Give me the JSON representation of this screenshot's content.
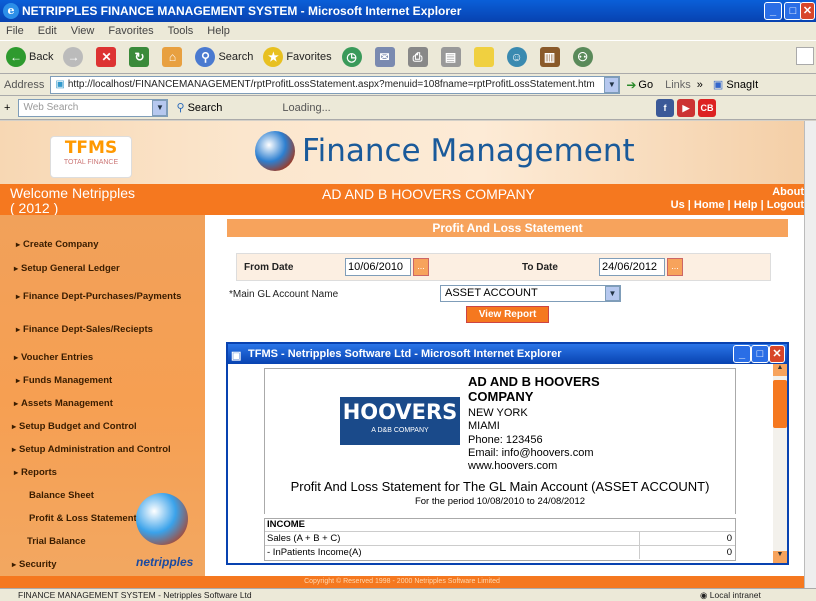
{
  "window": {
    "title": "NETRIPPLES FINANCE MANAGEMENT SYSTEM - Microsoft Internet Explorer"
  },
  "menu": [
    "File",
    "Edit",
    "View",
    "Favorites",
    "Tools",
    "Help"
  ],
  "toolbar": {
    "back": "Back",
    "search": "Search",
    "favorites": "Favorites"
  },
  "address": {
    "label": "Address",
    "url": "http://localhost/FINANCEMANAGEMENT/rptProfitLossStatement.aspx?menuid=108fname=rptProfitLossStatement.htm",
    "go": "Go",
    "links": "Links",
    "snagit": "SnagIt"
  },
  "searchbar": {
    "placeholder": "Web Search",
    "search": "Search",
    "loading": "Loading..."
  },
  "banner": {
    "logo": "TFMS",
    "logo_sub": "TOTAL FINANCE",
    "title": "Finance Management"
  },
  "header": {
    "welcome": "Welcome  Netripples",
    "year": "( 2012 )",
    "company": "AD AND B HOOVERS COMPANY",
    "about": "About",
    "links": [
      "Us",
      "Home",
      "Help",
      "Logout"
    ]
  },
  "sidebar": {
    "items": [
      "Create Company",
      "Setup General Ledger",
      "Finance Dept-Purchases/Payments",
      "Finance Dept-Sales/Reciepts",
      "Voucher Entries",
      "Funds Management",
      "Assets Management",
      "Setup Budget and Control",
      "Setup Administration and Control",
      "Reports",
      "Security"
    ],
    "reports_sub": [
      "Balance Sheet",
      "Profit & Loss Statement",
      "Trial Balance"
    ],
    "brand": "netripples"
  },
  "form": {
    "header": "Profit And Loss Statement",
    "from_label": "From Date",
    "from_value": "10/06/2010",
    "to_label": "To Date",
    "to_value": "24/06/2012",
    "gl_label": "*Main GL Account Name",
    "gl_value": "ASSET ACCOUNT",
    "view_btn": "View Report"
  },
  "popup": {
    "title": "TFMS - Netripples Software Ltd - Microsoft Internet Explorer",
    "company": "AD AND B HOOVERS COMPANY",
    "address": [
      "NEW YORK",
      "MIAMI",
      "Phone: 123456",
      "Email: info@hoovers.com",
      "www.hoovers.com"
    ],
    "logo": "HOOVERS",
    "logo_sub": "A D&B COMPANY",
    "report_title": "Profit And Loss Statement for The GL Main Account (ASSET ACCOUNT)",
    "period": "For the period  10/08/2010  to  24/08/2012",
    "rows": [
      {
        "label": "INCOME",
        "value": ""
      },
      {
        "label": "Sales (A + B + C)",
        "value": "0"
      },
      {
        "label": "- InPatients Income(A)",
        "value": "0"
      }
    ]
  },
  "footer": "Copyright © Reserved 1998 - 2000 Netripples Software Limited",
  "status": {
    "text": "FINANCE MANAGEMENT SYSTEM - Netripples Software Ltd",
    "zone": "Local intranet"
  }
}
